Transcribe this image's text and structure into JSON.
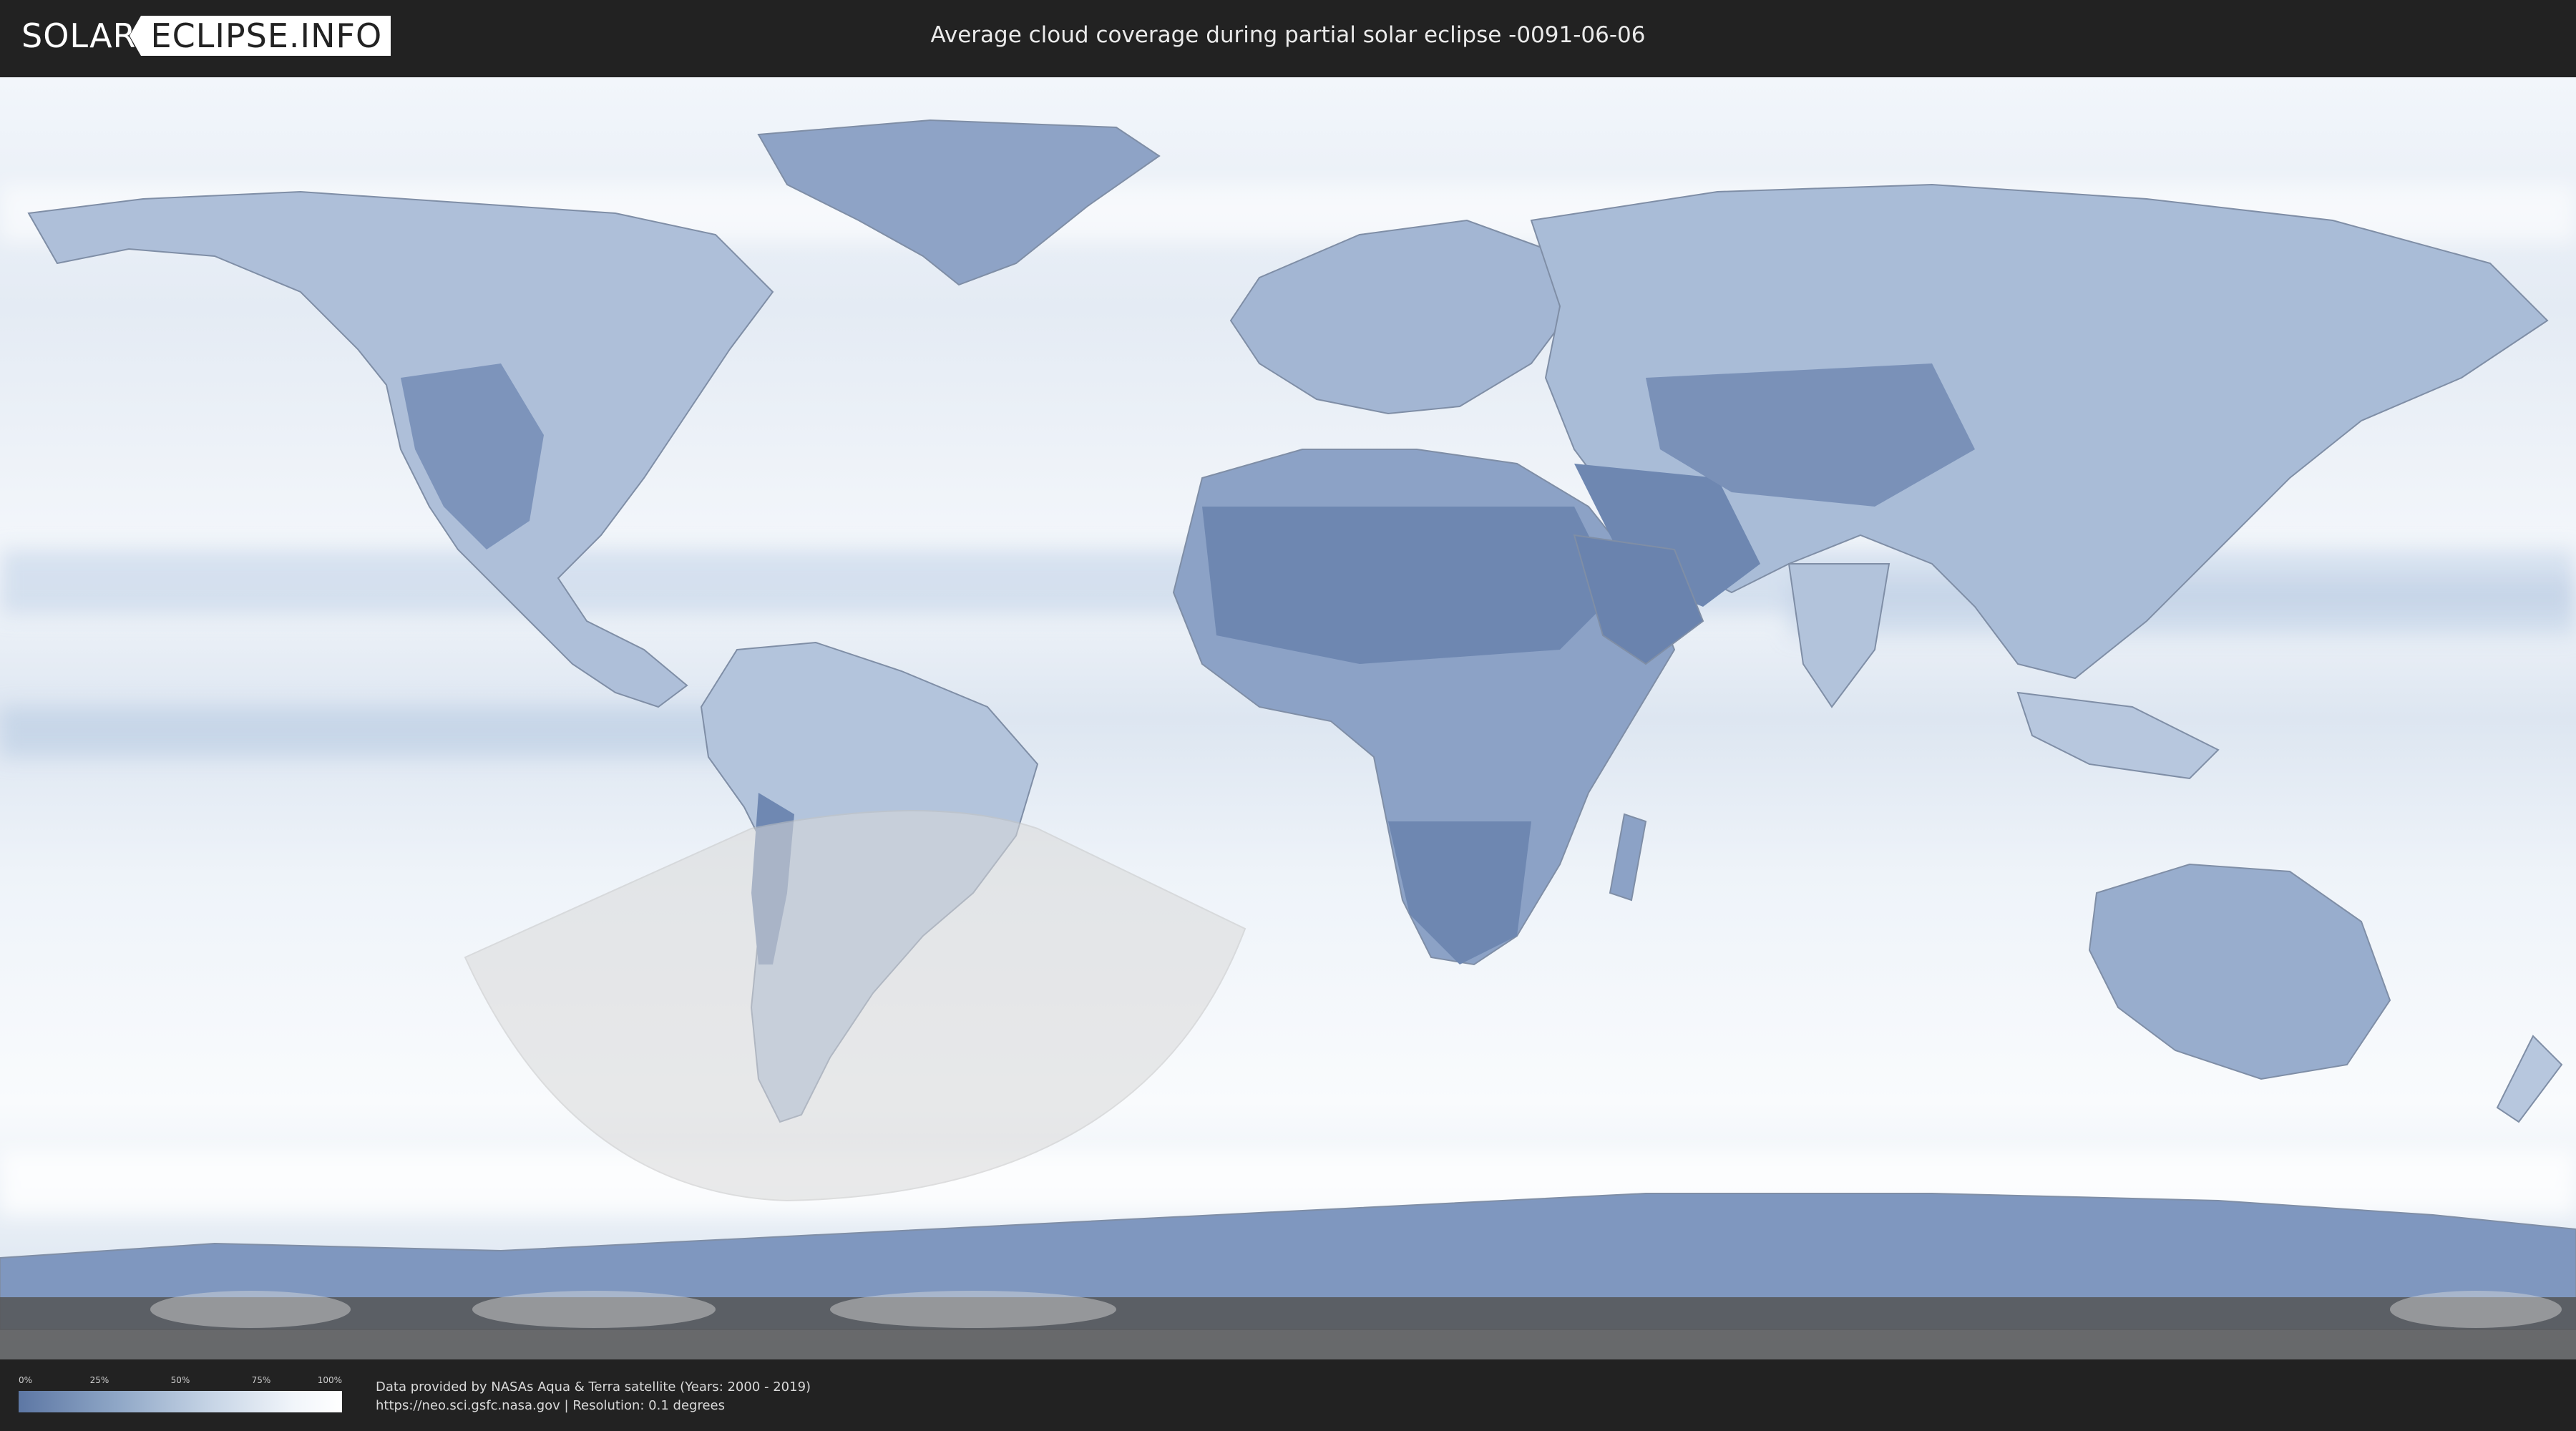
{
  "logo": {
    "left": "SOLAR",
    "right": "ECLIPSE.INFO"
  },
  "title": "Average cloud coverage during partial solar eclipse -0091-06-06",
  "map": {
    "layer": "average cloud coverage",
    "colors": {
      "clear": "#5d77a4",
      "cloudy": "#ffffff",
      "eclipse_overlay": "#d9d9d9"
    }
  },
  "legend": {
    "ticks": [
      "0%",
      "25%",
      "50%",
      "75%",
      "100%"
    ]
  },
  "credits": {
    "line1": "Data provided by NASAs Aqua & Terra satellite (Years: 2000 - 2019)",
    "line2": "https://neo.sci.gsfc.nasa.gov | Resolution: 0.1 degrees"
  }
}
